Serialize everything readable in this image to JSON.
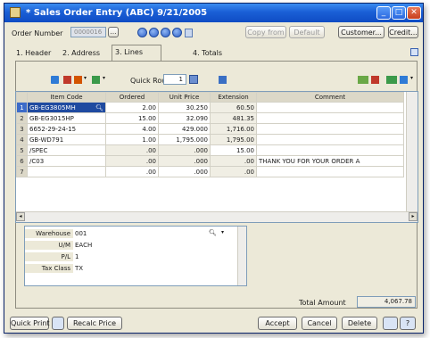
{
  "window": {
    "title": "* Sales Order Entry (ABC) 9/21/2005",
    "min_symbol": "_",
    "max_symbol": "□",
    "close_symbol": "✕"
  },
  "header": {
    "order_number_label": "Order Number",
    "order_number_value": "0000016",
    "buttons": {
      "copy_from": "Copy from",
      "default": "Default",
      "customer": "Customer...",
      "credit": "Credit..."
    }
  },
  "tabs": [
    {
      "label": "1. Header"
    },
    {
      "label": "2. Address"
    },
    {
      "label": "3. Lines"
    },
    {
      "label": "4. Totals"
    }
  ],
  "toolbar": {
    "quick_row_label": "Quick Row",
    "quick_row_value": "1"
  },
  "grid": {
    "columns": [
      "",
      "Item Code",
      "Ordered",
      "Unit Price",
      "Extension",
      "Comment"
    ],
    "rows": [
      {
        "n": "1",
        "item": "GB-EG3805MH",
        "ordered": "2.00",
        "price": "30.250",
        "ext": "60.50",
        "comment": ""
      },
      {
        "n": "2",
        "item": "GB-EG3015HP",
        "ordered": "15.00",
        "price": "32.090",
        "ext": "481.35",
        "comment": ""
      },
      {
        "n": "3",
        "item": "6652-29-24-15",
        "ordered": "4.00",
        "price": "429.000",
        "ext": "1,716.00",
        "comment": ""
      },
      {
        "n": "4",
        "item": "GB-WD791",
        "ordered": "1.00",
        "price": "1,795.000",
        "ext": "1,795.00",
        "comment": ""
      },
      {
        "n": "5",
        "item": "/SPEC",
        "ordered": ".00",
        "price": ".000",
        "ext": "15.00",
        "comment": ""
      },
      {
        "n": "6",
        "item": "/C03",
        "ordered": ".00",
        "price": ".000",
        "ext": ".00",
        "comment": "THANK YOU FOR YOUR ORDER A"
      },
      {
        "n": "7",
        "item": "",
        "ordered": ".00",
        "price": ".000",
        "ext": ".00",
        "comment": ""
      }
    ]
  },
  "detail": {
    "rows": [
      {
        "label": "Warehouse",
        "value": "001"
      },
      {
        "label": "U/M",
        "value": "EACH"
      },
      {
        "label": "P/L",
        "value": "1"
      },
      {
        "label": "Tax Class",
        "value": "TX"
      }
    ]
  },
  "totals": {
    "total_amount_label": "Total Amount",
    "total_amount_value": "4,067.78"
  },
  "footer": {
    "quick_print": "Quick Print",
    "recalc_price": "Recalc Price",
    "accept": "Accept",
    "cancel": "Cancel",
    "delete": "Delete"
  }
}
